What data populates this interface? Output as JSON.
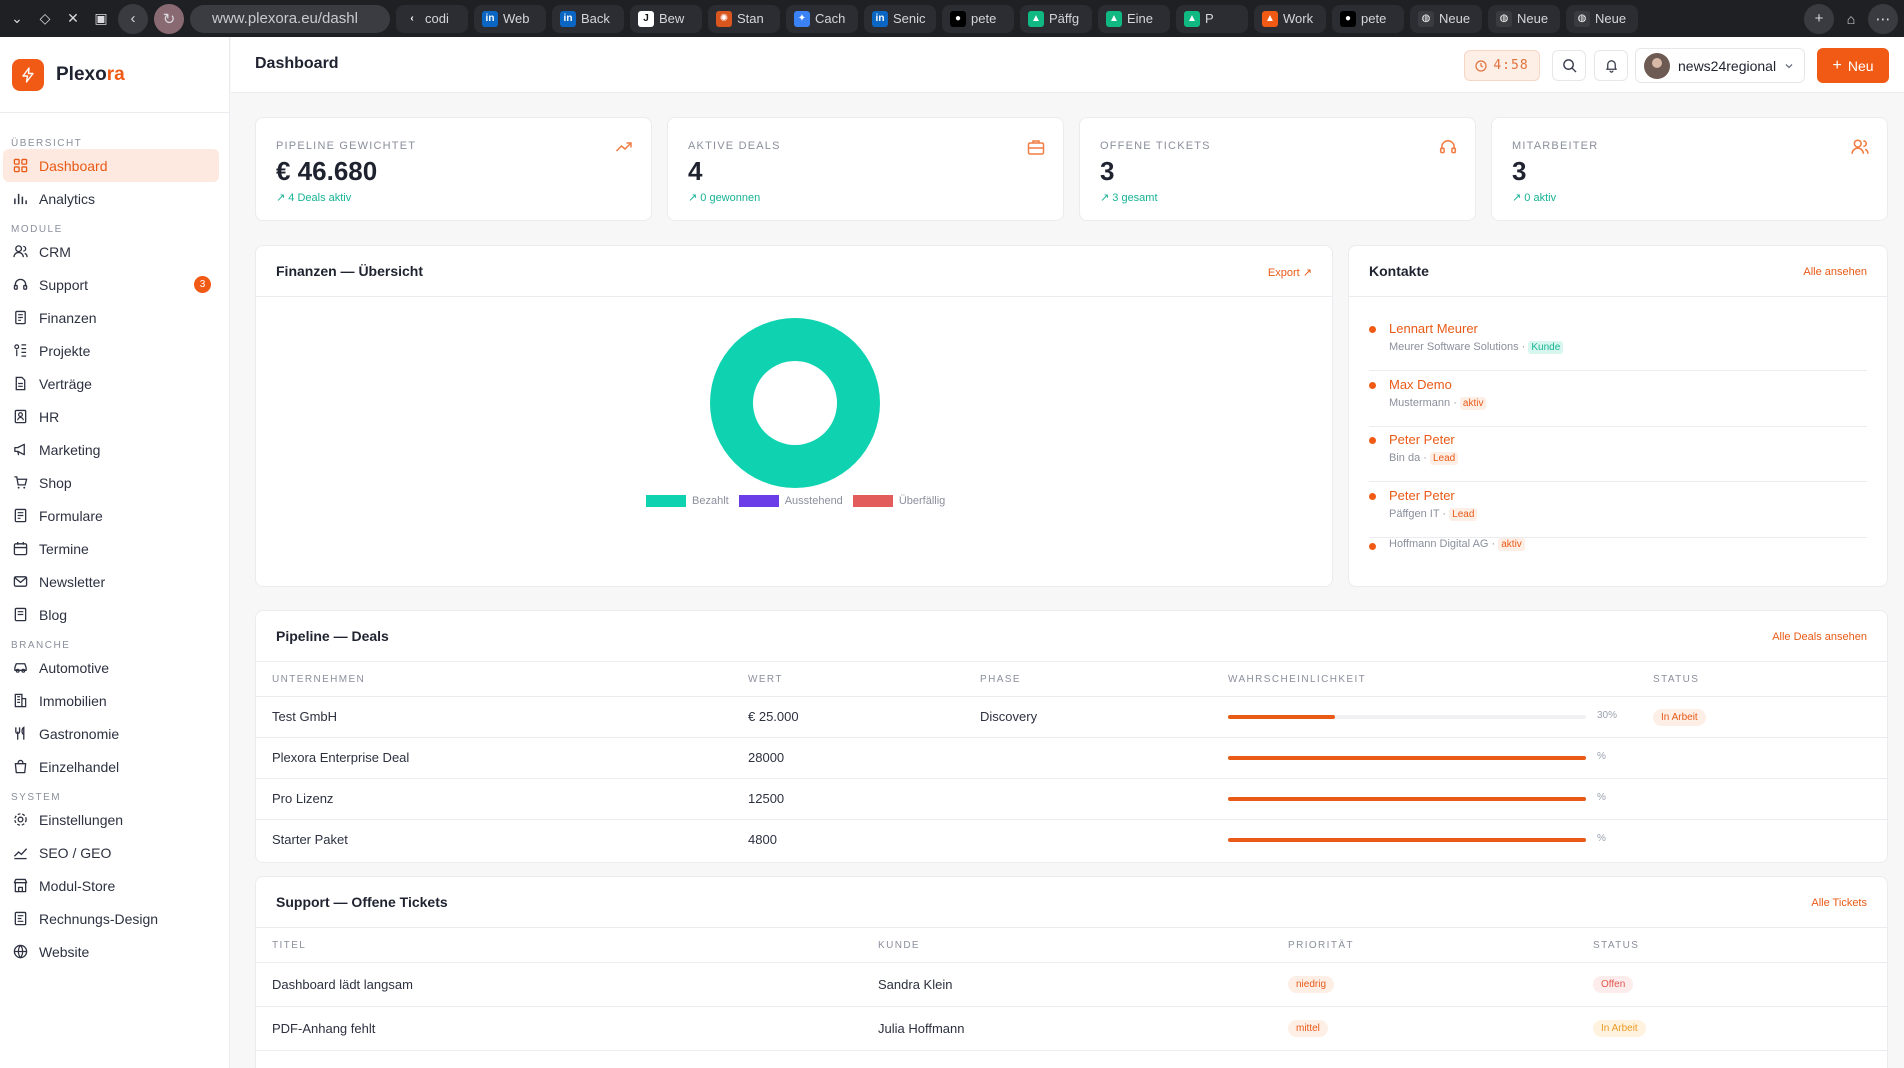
{
  "browser": {
    "url": "www.plexora.eu/dashl",
    "tabs": [
      {
        "label": "codi",
        "fav": "‹",
        "color": "#2c2d32"
      },
      {
        "label": "Web",
        "fav": "in",
        "color": "#0a66c2"
      },
      {
        "label": "Back",
        "fav": "in",
        "color": "#0a66c2"
      },
      {
        "label": "Bew",
        "fav": "J",
        "color": "#ffffff"
      },
      {
        "label": "Stan",
        "fav": "✺",
        "color": "#d9571f"
      },
      {
        "label": "Cach",
        "fav": "✦",
        "color": "#3b82f6"
      },
      {
        "label": "Senic",
        "fav": "in",
        "color": "#0a66c2"
      },
      {
        "label": "pete",
        "fav": "●",
        "color": "#000000"
      },
      {
        "label": "Päffg",
        "fav": "▲",
        "color": "#10b981"
      },
      {
        "label": "Eine",
        "fav": "▲",
        "color": "#10b981"
      },
      {
        "label": "P",
        "fav": "▲",
        "color": "#10b981"
      },
      {
        "label": "Work",
        "fav": "▲",
        "color": "#f05a14"
      },
      {
        "label": "pete",
        "fav": "●",
        "color": "#000000"
      },
      {
        "label": "Neue",
        "fav": "◍",
        "color": "#3a3b40"
      },
      {
        "label": "Neue",
        "fav": "◍",
        "color": "#3a3b40"
      },
      {
        "label": "Neue",
        "fav": "◍",
        "color": "#3a3b40"
      }
    ]
  },
  "brand": {
    "name_main": "Plexo",
    "name_accent": "ra"
  },
  "sidebar": {
    "sections": [
      {
        "title": "ÜBERSICHT",
        "items": [
          {
            "label": "Dashboard",
            "icon": "grid-icon",
            "active": true
          },
          {
            "label": "Analytics",
            "icon": "bar-chart-icon"
          }
        ]
      },
      {
        "title": "MODULE",
        "items": [
          {
            "label": "CRM",
            "icon": "users-icon"
          },
          {
            "label": "Support",
            "icon": "headset-icon",
            "badge": "3"
          },
          {
            "label": "Finanzen",
            "icon": "receipt-icon"
          },
          {
            "label": "Projekte",
            "icon": "kanban-icon"
          },
          {
            "label": "Verträge",
            "icon": "file-icon"
          },
          {
            "label": "HR",
            "icon": "id-card-icon"
          },
          {
            "label": "Marketing",
            "icon": "megaphone-icon"
          },
          {
            "label": "Shop",
            "icon": "cart-icon"
          },
          {
            "label": "Formulare",
            "icon": "form-icon"
          },
          {
            "label": "Termine",
            "icon": "calendar-icon"
          },
          {
            "label": "Newsletter",
            "icon": "mail-icon"
          },
          {
            "label": "Blog",
            "icon": "book-icon"
          }
        ]
      },
      {
        "title": "BRANCHE",
        "items": [
          {
            "label": "Automotive",
            "icon": "car-icon"
          },
          {
            "label": "Immobilien",
            "icon": "building-icon"
          },
          {
            "label": "Gastronomie",
            "icon": "fork-knife-icon"
          },
          {
            "label": "Einzelhandel",
            "icon": "shopping-bag-icon"
          }
        ]
      },
      {
        "title": "SYSTEM",
        "items": [
          {
            "label": "Einstellungen",
            "icon": "gear-icon"
          },
          {
            "label": "SEO / GEO",
            "icon": "trend-icon"
          },
          {
            "label": "Modul-Store",
            "icon": "store-icon"
          },
          {
            "label": "Rechnungs-Design",
            "icon": "palette-icon"
          },
          {
            "label": "Website",
            "icon": "globe-icon"
          }
        ]
      }
    ]
  },
  "header": {
    "title": "Dashboard",
    "timer": "4:58",
    "user": "news24regional",
    "new_label": "Neu"
  },
  "kpis": [
    {
      "label": "PIPELINE GEWICHTET",
      "value": "€ 46.680",
      "sub": "↗ 4 Deals aktiv",
      "icon": "trend-up-icon"
    },
    {
      "label": "AKTIVE DEALS",
      "value": "4",
      "sub": "↗ 0 gewonnen",
      "icon": "briefcase-icon"
    },
    {
      "label": "OFFENE TICKETS",
      "value": "3",
      "sub": "↗ 3 gesamt",
      "icon": "headset-icon"
    },
    {
      "label": "MITARBEITER",
      "value": "3",
      "sub": "↗ 0 aktiv",
      "icon": "users-icon"
    }
  ],
  "finance": {
    "title": "Finanzen — Übersicht",
    "link": "Export ↗"
  },
  "chart_data": {
    "type": "pie",
    "donut": true,
    "categories": [
      "Bezahlt",
      "Ausstehend",
      "Überfällig"
    ],
    "values": [
      100,
      0,
      0
    ],
    "colors": [
      "#0fd3b0",
      "#6a3de8",
      "#e25c5c"
    ],
    "legend": "bottom"
  },
  "contacts": {
    "title": "Kontakte",
    "link": "Alle ansehen",
    "items": [
      {
        "name": "Lennart Meurer",
        "sub": "Meurer Software Solutions ·",
        "tag": "Kunde",
        "tag_type": "kunde"
      },
      {
        "name": "Max Demo",
        "sub": "Mustermann ·",
        "tag": "aktiv",
        "tag_type": "aktiv"
      },
      {
        "name": "Peter Peter",
        "sub": "Bin da ·",
        "tag": "Lead",
        "tag_type": "lead"
      },
      {
        "name": "Peter Peter",
        "sub": "Päffgen IT ·",
        "tag": "Lead",
        "tag_type": "lead"
      },
      {
        "name": "",
        "sub": "Hoffmann Digital AG ·",
        "tag": "aktiv",
        "tag_type": "aktiv"
      }
    ]
  },
  "pipeline": {
    "title": "Pipeline — Deals",
    "link": "Alle Deals ansehen",
    "columns": [
      "UNTERNEHMEN",
      "WERT",
      "PHASE",
      "WAHRSCHEINLICHKEIT",
      "STATUS"
    ],
    "rows": [
      {
        "company": "Test GmbH",
        "value": "€ 25.000",
        "phase": "Discovery",
        "probability": 30,
        "prob_label": "30%",
        "status": "In Arbeit"
      },
      {
        "company": "Plexora Enterprise Deal",
        "value": "28000",
        "phase": "",
        "probability": 100,
        "prob_label": "%",
        "status": ""
      },
      {
        "company": "Pro Lizenz",
        "value": "12500",
        "phase": "",
        "probability": 100,
        "prob_label": "%",
        "status": ""
      },
      {
        "company": "Starter Paket",
        "value": "4800",
        "phase": "",
        "probability": 100,
        "prob_label": "%",
        "status": ""
      }
    ]
  },
  "tickets": {
    "title": "Support — Offene Tickets",
    "link": "Alle Tickets",
    "columns": [
      "TITEL",
      "KUNDE",
      "PRIORITÄT",
      "STATUS"
    ],
    "rows": [
      {
        "title": "Dashboard lädt langsam",
        "customer": "Sandra Klein",
        "priority": "niedrig",
        "status": "Offen",
        "status_type": "offen"
      },
      {
        "title": "PDF-Anhang fehlt",
        "customer": "Julia Hoffmann",
        "priority": "mittel",
        "status": "In Arbeit",
        "status_type": "arbeit"
      }
    ]
  }
}
